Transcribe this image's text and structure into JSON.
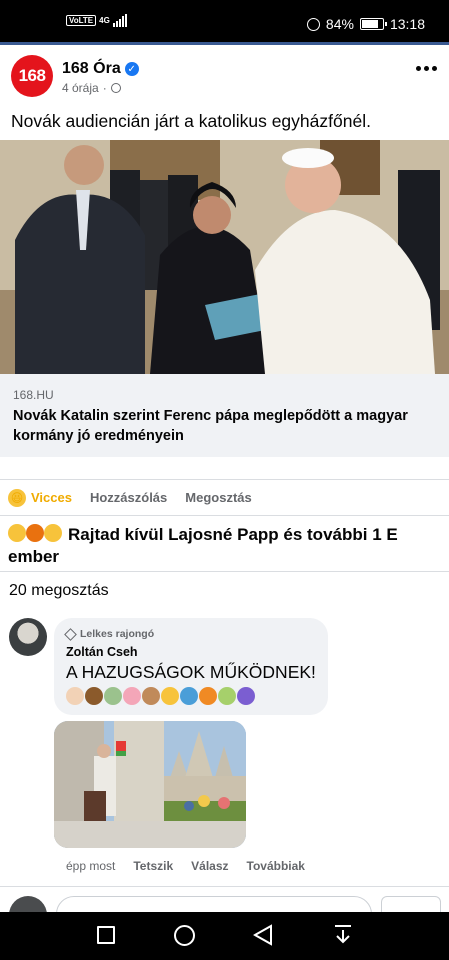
{
  "status_bar": {
    "carrier": "VoLTE",
    "network": "4G",
    "battery": "84%",
    "battery_level": 0.84,
    "time": "13:18"
  },
  "post": {
    "avatar_text": "168",
    "page_name": "168 Óra",
    "time": "4 órája",
    "text": "Novák audiencián járt a katolikus egyházfőnél.",
    "link": {
      "domain": "168.HU",
      "title": "Novák Katalin szerint Ferenc pápa meglepődött a magyar kormány jó eredményein"
    }
  },
  "actions": {
    "react": "Vicces",
    "comment": "Hozzászólás",
    "share": "Megosztás"
  },
  "reactions_text": "Rajtad kívül Lajosné Papp és további 1 E ember",
  "shares_text": "20 megosztás",
  "comment": {
    "badge": "Lelkes rajongó",
    "author": "Zoltán Cseh",
    "text": "A HAZUGSÁGOK MŰKÖDNEK!",
    "time": "épp most",
    "like": "Tetszik",
    "reply": "Válasz",
    "more": "Továbbiak"
  },
  "colors": {
    "brand_red": "#e4141c",
    "facebook_blue": "#1877f2",
    "haha_yellow": "#f0ab00",
    "secondary_text": "#65676b"
  }
}
